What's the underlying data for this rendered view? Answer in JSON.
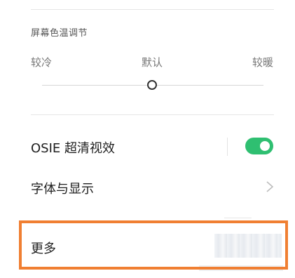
{
  "color_temperature": {
    "title": "屏幕色温调节",
    "labels": {
      "cool": "较冷",
      "default": "默认",
      "warm": "较暖"
    },
    "slider_value": "default"
  },
  "settings": {
    "osie": {
      "label": "OSIE 超清视效",
      "enabled": true,
      "toggle_color": "#2fbf71"
    },
    "font_display": {
      "label": "字体与显示"
    },
    "more": {
      "label": "更多"
    }
  },
  "highlight_color": "#f07f32",
  "icons": {
    "chevron": "chevron-right-icon"
  }
}
